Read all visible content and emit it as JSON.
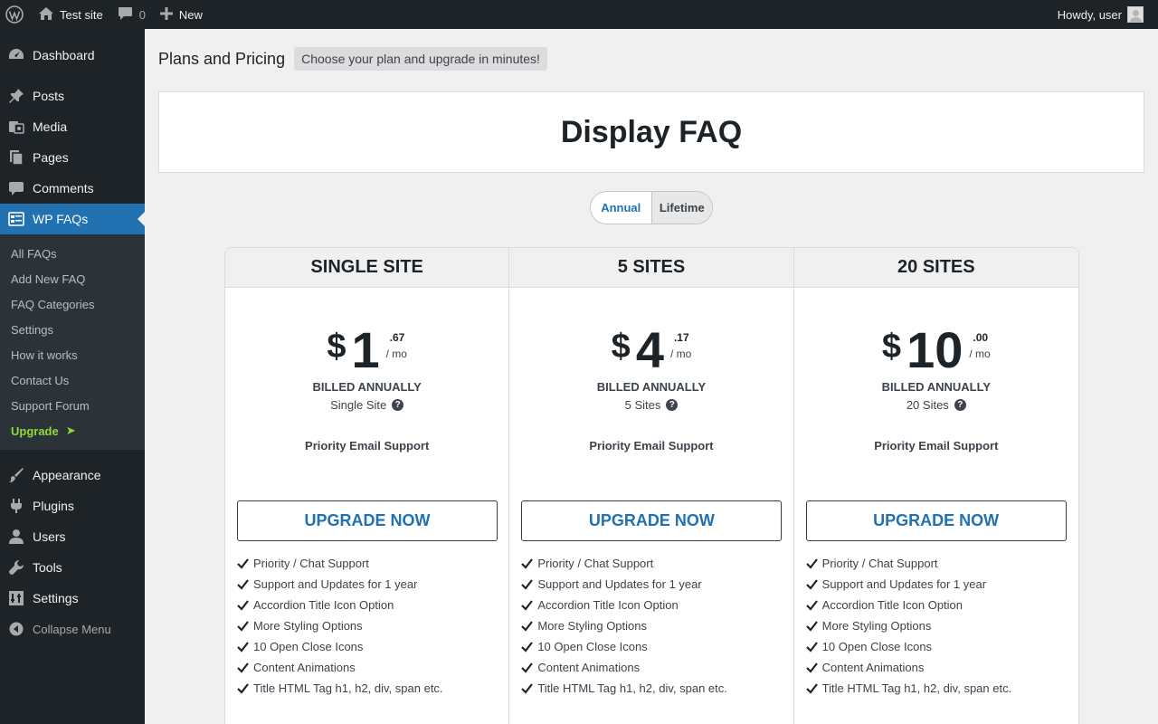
{
  "adminbar": {
    "site_name": "Test site",
    "comments_count": "0",
    "new_label": "New",
    "greeting": "Howdy, user"
  },
  "sidebar": {
    "top_items": [
      {
        "label": "Dashboard",
        "icon": "dashboard-icon"
      }
    ],
    "items": [
      {
        "label": "Posts",
        "icon": "pin-icon"
      },
      {
        "label": "Media",
        "icon": "media-icon"
      },
      {
        "label": "Pages",
        "icon": "pages-icon"
      },
      {
        "label": "Comments",
        "icon": "comment-icon"
      },
      {
        "label": "WP FAQs",
        "icon": "faq-icon",
        "active": true
      }
    ],
    "submenu": [
      {
        "label": "All FAQs"
      },
      {
        "label": "Add New FAQ"
      },
      {
        "label": "FAQ Categories"
      },
      {
        "label": "Settings"
      },
      {
        "label": "How it works"
      },
      {
        "label": "Contact Us"
      },
      {
        "label": "Support Forum"
      },
      {
        "label": "Upgrade",
        "arrow": "➤"
      }
    ],
    "bottom_items": [
      {
        "label": "Appearance",
        "icon": "brush-icon"
      },
      {
        "label": "Plugins",
        "icon": "plug-icon"
      },
      {
        "label": "Users",
        "icon": "user-icon"
      },
      {
        "label": "Tools",
        "icon": "wrench-icon"
      },
      {
        "label": "Settings",
        "icon": "settings-icon"
      }
    ],
    "collapse_label": "Collapse Menu"
  },
  "page": {
    "title": "Plans and Pricing",
    "subtitle": "Choose your plan and upgrade in minutes!",
    "header": "Display FAQ",
    "toggle": {
      "annual": "Annual",
      "lifetime": "Lifetime",
      "selected": "Annual"
    }
  },
  "plans": [
    {
      "name": "SINGLE SITE",
      "currency": "$",
      "amount": "1",
      "cents": ".67",
      "per": "/ mo",
      "billed": "BILLED ANNUALLY",
      "sites": "Single Site",
      "support": "Priority Email Support",
      "button": "UPGRADE NOW",
      "features": [
        "Priority / Chat Support",
        "Support and Updates for 1 year",
        "Accordion Title Icon Option",
        "More Styling Options",
        "10 Open Close Icons",
        "Content Animations",
        "Title HTML Tag h1, h2, div, span etc."
      ]
    },
    {
      "name": "5 SITES",
      "currency": "$",
      "amount": "4",
      "cents": ".17",
      "per": "/ mo",
      "billed": "BILLED ANNUALLY",
      "sites": "5 Sites",
      "support": "Priority Email Support",
      "button": "UPGRADE NOW",
      "features": [
        "Priority / Chat Support",
        "Support and Updates for 1 year",
        "Accordion Title Icon Option",
        "More Styling Options",
        "10 Open Close Icons",
        "Content Animations",
        "Title HTML Tag h1, h2, div, span etc."
      ]
    },
    {
      "name": "20 SITES",
      "currency": "$",
      "amount": "10",
      "cents": ".00",
      "per": "/ mo",
      "billed": "BILLED ANNUALLY",
      "sites": "20 Sites",
      "support": "Priority Email Support",
      "button": "UPGRADE NOW",
      "features": [
        "Priority / Chat Support",
        "Support and Updates for 1 year",
        "Accordion Title Icon Option",
        "More Styling Options",
        "10 Open Close Icons",
        "Content Animations",
        "Title HTML Tag h1, h2, div, span etc."
      ]
    }
  ],
  "colors": {
    "accent": "#2271b1",
    "upgrade": "#8fd93f",
    "admin_bg": "#1d2327"
  }
}
